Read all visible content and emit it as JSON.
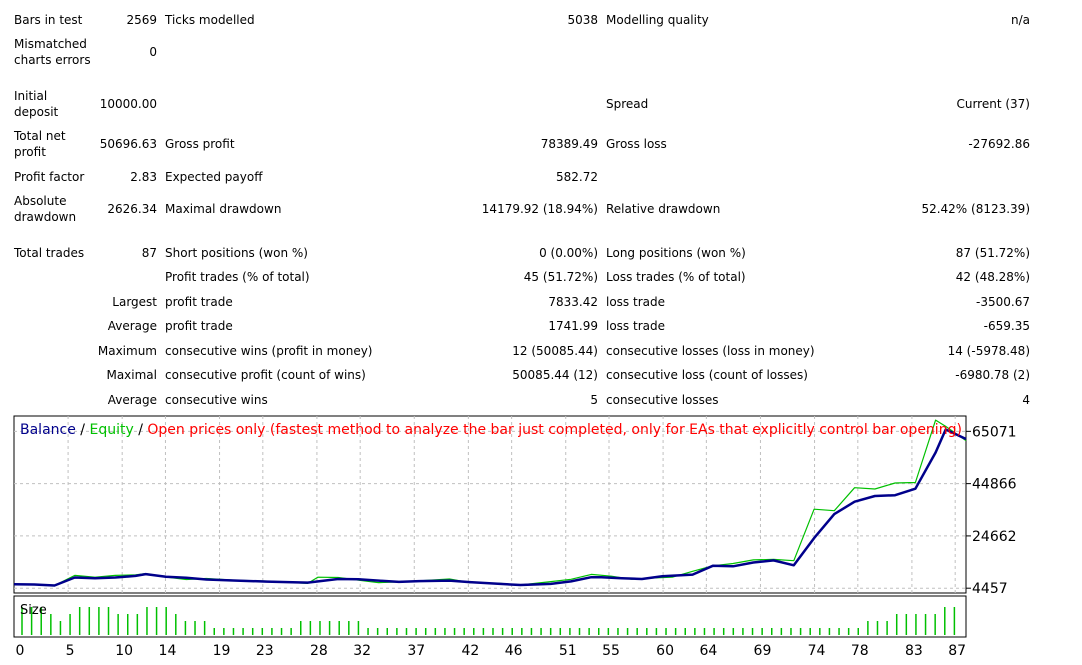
{
  "report": {
    "bars_in_test_label": "Bars in test",
    "bars_in_test_value": "2569",
    "ticks_modelled_label": "Ticks modelled",
    "ticks_modelled_value": "5038",
    "modelling_quality_label": "Modelling quality",
    "modelling_quality_value": "n/a",
    "mismatched_label": "Mismatched charts errors",
    "mismatched_value": "0",
    "initial_deposit_label": "Initial deposit",
    "initial_deposit_value": "10000.00",
    "spread_label": "Spread",
    "spread_value": "Current (37)",
    "total_net_profit_label": "Total net profit",
    "total_net_profit_value": "50696.63",
    "gross_profit_label": "Gross profit",
    "gross_profit_value": "78389.49",
    "gross_loss_label": "Gross loss",
    "gross_loss_value": "-27692.86",
    "profit_factor_label": "Profit factor",
    "profit_factor_value": "2.83",
    "expected_payoff_label": "Expected payoff",
    "expected_payoff_value": "582.72",
    "absolute_drawdown_label": "Absolute drawdown",
    "absolute_drawdown_value": "2626.34",
    "maximal_drawdown_label": "Maximal drawdown",
    "maximal_drawdown_value": "14179.92 (18.94%)",
    "relative_drawdown_label": "Relative drawdown",
    "relative_drawdown_value": "52.42% (8123.39)",
    "total_trades_label": "Total trades",
    "total_trades_value": "87",
    "short_positions_label": "Short positions (won %)",
    "short_positions_value": "0 (0.00%)",
    "long_positions_label": "Long positions (won %)",
    "long_positions_value": "87 (51.72%)",
    "profit_trades_label": "Profit trades (% of total)",
    "profit_trades_value": "45 (51.72%)",
    "loss_trades_label": "Loss trades (% of total)",
    "loss_trades_value": "42 (48.28%)",
    "largest_label": "Largest",
    "largest_profit_label": "profit trade",
    "largest_profit_value": "7833.42",
    "largest_loss_label": "loss trade",
    "largest_loss_value": "-3500.67",
    "average_label": "Average",
    "average_profit_label": "profit trade",
    "average_profit_value": "1741.99",
    "average_loss_label": "loss trade",
    "average_loss_value": "-659.35",
    "maximum_label": "Maximum",
    "max_cons_wins_label": "consecutive wins (profit in money)",
    "max_cons_wins_value": "12 (50085.44)",
    "max_cons_losses_label": "consecutive losses (loss in money)",
    "max_cons_losses_value": "14 (-5978.48)",
    "maximal_label": "Maximal",
    "maximal_cons_profit_label": "consecutive profit (count of wins)",
    "maximal_cons_profit_value": "50085.44 (12)",
    "maximal_cons_loss_label": "consecutive loss (count of losses)",
    "maximal_cons_loss_value": "-6980.78 (2)",
    "average2_label": "Average",
    "avg_cons_wins_label": "consecutive wins",
    "avg_cons_wins_value": "5",
    "avg_cons_losses_label": "consecutive losses",
    "avg_cons_losses_value": "4"
  },
  "chart_data": {
    "type": "line",
    "legend": {
      "balance": "Balance",
      "sep1": " / ",
      "equity": "Equity",
      "sep2": " / ",
      "mode": "Open prices only (fastest method to analyze the bar just completed, only for EAs that explicitly control bar opening)"
    },
    "y_ticks": [
      65071,
      44866,
      24662,
      4457
    ],
    "x_ticks": [
      0,
      5,
      10,
      14,
      19,
      23,
      28,
      32,
      37,
      42,
      46,
      51,
      55,
      60,
      64,
      69,
      74,
      78,
      83,
      87
    ],
    "size_label": "Size",
    "xlim": [
      0,
      88
    ],
    "ylim": [
      2600,
      71000
    ],
    "colors": {
      "balance": "#00008b",
      "equity": "#00c000",
      "mode": "#ff0000",
      "grid": "#c0c0c0",
      "size": "#00c000"
    },
    "series": [
      {
        "name": "Balance",
        "values": [
          [
            0,
            6000
          ],
          [
            2,
            5900
          ],
          [
            4,
            5500
          ],
          [
            6,
            8600
          ],
          [
            8,
            8300
          ],
          [
            10,
            8600
          ],
          [
            12,
            9200
          ],
          [
            13,
            9900
          ],
          [
            15,
            8900
          ],
          [
            17,
            8500
          ],
          [
            19,
            7800
          ],
          [
            22,
            7400
          ],
          [
            25,
            7000
          ],
          [
            29,
            6600
          ],
          [
            32,
            8000
          ],
          [
            34,
            7900
          ],
          [
            36,
            7400
          ],
          [
            38,
            6900
          ],
          [
            40,
            7200
          ],
          [
            43,
            7400
          ],
          [
            45,
            6800
          ],
          [
            48,
            6100
          ],
          [
            50,
            5700
          ],
          [
            53,
            6100
          ],
          [
            55,
            7100
          ],
          [
            57,
            8700
          ],
          [
            58,
            8700
          ],
          [
            60,
            8300
          ],
          [
            62,
            8000
          ],
          [
            64,
            9100
          ],
          [
            67,
            9700
          ],
          [
            69,
            13100
          ],
          [
            71,
            12900
          ],
          [
            73,
            14400
          ],
          [
            75,
            15200
          ],
          [
            77,
            13300
          ],
          [
            79,
            23800
          ],
          [
            81,
            33100
          ],
          [
            83,
            37900
          ],
          [
            85,
            40100
          ],
          [
            87,
            40400
          ],
          [
            89,
            42900
          ],
          [
            91,
            56900
          ],
          [
            92,
            65800
          ],
          [
            94,
            62100
          ]
        ]
      },
      {
        "name": "Equity",
        "values": [
          [
            0,
            6000
          ],
          [
            2,
            5900
          ],
          [
            4,
            5500
          ],
          [
            6,
            9400
          ],
          [
            8,
            8700
          ],
          [
            10,
            9400
          ],
          [
            12,
            9600
          ],
          [
            13,
            10100
          ],
          [
            15,
            8800
          ],
          [
            17,
            7800
          ],
          [
            19,
            8200
          ],
          [
            22,
            7500
          ],
          [
            25,
            7200
          ],
          [
            29,
            6300
          ],
          [
            30,
            8700
          ],
          [
            32,
            8600
          ],
          [
            34,
            7600
          ],
          [
            36,
            6600
          ],
          [
            38,
            6900
          ],
          [
            40,
            7300
          ],
          [
            43,
            8000
          ],
          [
            45,
            6600
          ],
          [
            48,
            6300
          ],
          [
            50,
            5700
          ],
          [
            53,
            7000
          ],
          [
            55,
            7900
          ],
          [
            57,
            9800
          ],
          [
            59,
            9100
          ],
          [
            61,
            7900
          ],
          [
            63,
            8400
          ],
          [
            65,
            8700
          ],
          [
            67,
            11000
          ],
          [
            69,
            13100
          ],
          [
            71,
            14000
          ],
          [
            73,
            15400
          ],
          [
            75,
            15600
          ],
          [
            77,
            15100
          ],
          [
            79,
            35000
          ],
          [
            81,
            34400
          ],
          [
            83,
            43300
          ],
          [
            85,
            42800
          ],
          [
            87,
            45100
          ],
          [
            89,
            45300
          ],
          [
            91,
            69400
          ],
          [
            92,
            67000
          ],
          [
            94,
            61500
          ]
        ]
      }
    ],
    "size_values": [
      4,
      4,
      4,
      3,
      2,
      3,
      4,
      4,
      4,
      4,
      3,
      3,
      3,
      4,
      4,
      4,
      3,
      2,
      2,
      2,
      1,
      1,
      1,
      1,
      1,
      1,
      1,
      1,
      1,
      2,
      2,
      2,
      2,
      2,
      2,
      2,
      1,
      1,
      1,
      1,
      1,
      1,
      1,
      1,
      1,
      1,
      1,
      1,
      1,
      1,
      1,
      1,
      1,
      1,
      1,
      1,
      1,
      1,
      1,
      1,
      1,
      1,
      1,
      1,
      1,
      1,
      1,
      1,
      1,
      1,
      1,
      1,
      1,
      1,
      1,
      1,
      1,
      1,
      1,
      1,
      1,
      1,
      1,
      1,
      1,
      1,
      1,
      1,
      2,
      2,
      2,
      3,
      3,
      3,
      3,
      3,
      4,
      4
    ]
  }
}
